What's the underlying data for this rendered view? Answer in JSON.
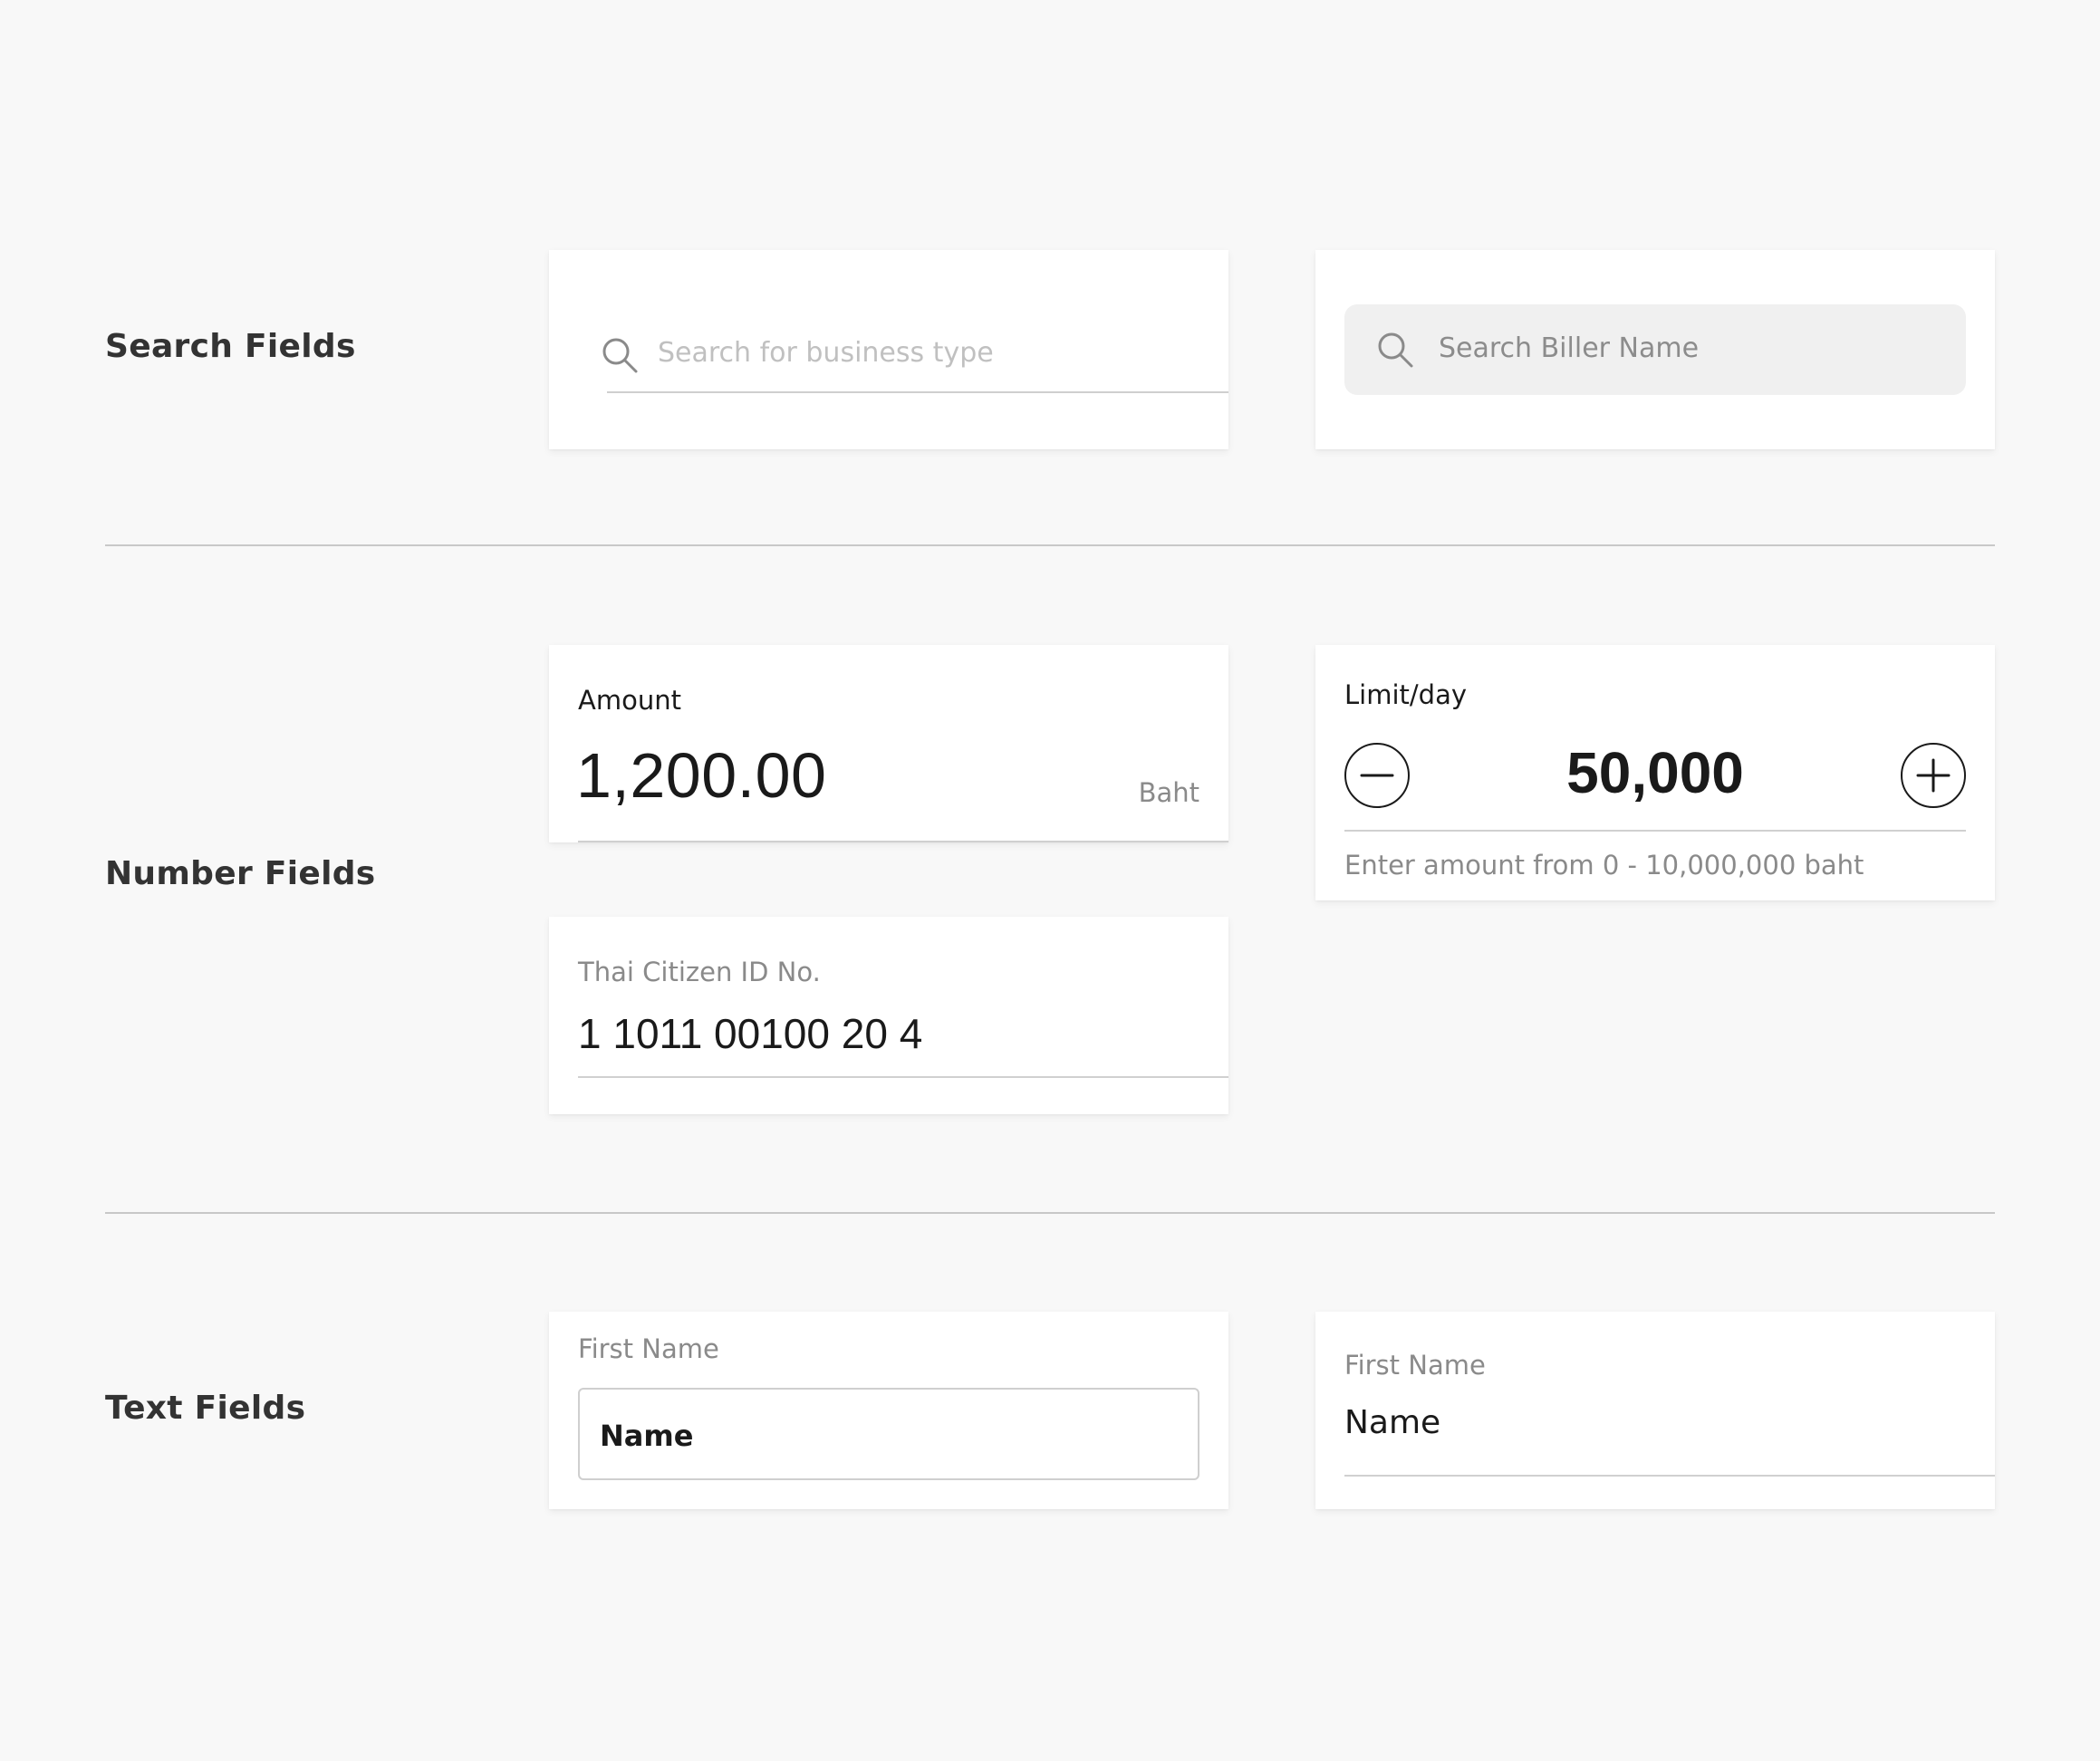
{
  "sections": {
    "search": {
      "title": "Search Fields"
    },
    "number": {
      "title": "Number Fields"
    },
    "text": {
      "title": "Text Fields"
    }
  },
  "search_fields": {
    "underline_style": {
      "placeholder": "Search for business type",
      "icon": "search-icon"
    },
    "pill_style": {
      "placeholder": "Search Biller Name",
      "icon": "search-icon"
    }
  },
  "number_fields": {
    "amount": {
      "label": "Amount",
      "value": "1,200.00",
      "unit": "Baht"
    },
    "limit": {
      "label": "Limit/day",
      "value": "50,000",
      "hint": "Enter amount from 0 - 10,000,000 baht",
      "decrement_icon": "minus-circle-icon",
      "increment_icon": "plus-circle-icon"
    },
    "citizen_id": {
      "label": "Thai Citizen ID No.",
      "value": "1 1011 00100 20 4"
    }
  },
  "text_fields": {
    "boxed": {
      "label": "First Name",
      "value": "Name"
    },
    "underlined": {
      "label": "First Name",
      "value": "Name"
    }
  },
  "colors": {
    "background": "#f8f8f8",
    "card": "#ffffff",
    "text": "#1a1a1a",
    "muted_text": "#8a8a8a",
    "divider": "#c8c8c8"
  }
}
